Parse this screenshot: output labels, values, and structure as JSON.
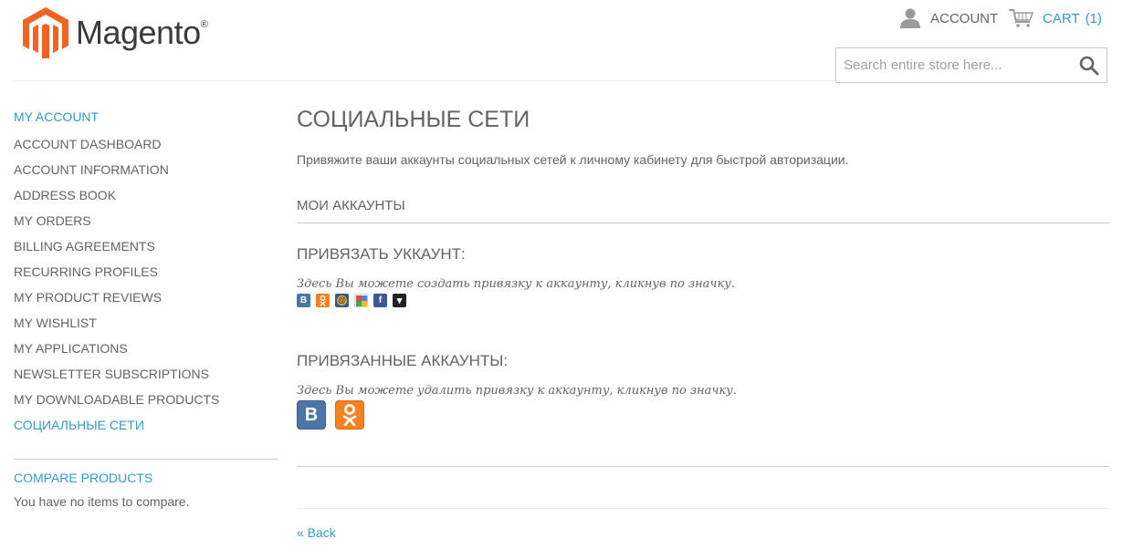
{
  "header": {
    "logo_text": "Magento",
    "logo_mark": "®",
    "account_label": "ACCOUNT",
    "cart_label": "CART",
    "cart_count": "(1)",
    "search_placeholder": "Search entire store here..."
  },
  "sidebar": {
    "title": "MY ACCOUNT",
    "items": [
      {
        "label": "ACCOUNT DASHBOARD",
        "active": false
      },
      {
        "label": "ACCOUNT INFORMATION",
        "active": false
      },
      {
        "label": "ADDRESS BOOK",
        "active": false
      },
      {
        "label": "MY ORDERS",
        "active": false
      },
      {
        "label": "BILLING AGREEMENTS",
        "active": false
      },
      {
        "label": "RECURRING PROFILES",
        "active": false
      },
      {
        "label": "MY PRODUCT REVIEWS",
        "active": false
      },
      {
        "label": "MY WISHLIST",
        "active": false
      },
      {
        "label": "MY APPLICATIONS",
        "active": false
      },
      {
        "label": "NEWSLETTER SUBSCRIPTIONS",
        "active": false
      },
      {
        "label": "MY DOWNLOADABLE PRODUCTS",
        "active": false
      },
      {
        "label": "СОЦИАЛЬНЫЕ СЕТИ",
        "active": true
      }
    ],
    "compare": {
      "title": "COMPARE PRODUCTS",
      "empty_text": "You have no items to compare."
    }
  },
  "main": {
    "title": "СОЦИАЛЬНЫЕ СЕТИ",
    "intro": "Привяжите ваши аккаунты социальных сетей к личному кабинету для быстрой авторизации.",
    "my_accounts": "МОИ АККАУНТЫ",
    "bind": {
      "title": "ПРИВЯЗАТЬ УККАУНТ",
      "colon": ":",
      "hint": "Здесь Вы можете создать привязку к аккаунту, кликнув по значку.",
      "providers": [
        {
          "name": "vkontakte",
          "icon": "vk-icon",
          "glyph": "B",
          "color": "#4a76a8"
        },
        {
          "name": "odnoklassniki",
          "icon": "odnoklassniki-icon",
          "glyph": "ok",
          "color": "#f58220"
        },
        {
          "name": "mailru",
          "icon": "mailru-icon",
          "glyph": "@",
          "color": "#168de2"
        },
        {
          "name": "google",
          "icon": "google-icon",
          "glyph": "g",
          "color": "#dd4b39"
        },
        {
          "name": "facebook",
          "icon": "facebook-icon",
          "glyph": "f",
          "color": "#3b5998"
        },
        {
          "name": "more",
          "icon": "dropdown-icon",
          "glyph": "▾",
          "color": "#222222"
        }
      ]
    },
    "linked": {
      "title": "ПРИВЯЗАННЫЕ АККАУНТЫ",
      "colon": ":",
      "hint": "Здесь Вы можете удалить привязку к аккаунту, кликнув по значку.",
      "providers": [
        {
          "name": "vkontakte",
          "icon": "vk-icon",
          "glyph": "B",
          "color": "#4a76a8"
        },
        {
          "name": "odnoklassniki",
          "icon": "odnoklassniki-icon",
          "glyph": "ok",
          "color": "#f58220"
        }
      ]
    },
    "back_label": "« Back"
  },
  "colors": {
    "accent": "#3399cc",
    "text": "#636363",
    "logo_orange": "#f26322"
  }
}
